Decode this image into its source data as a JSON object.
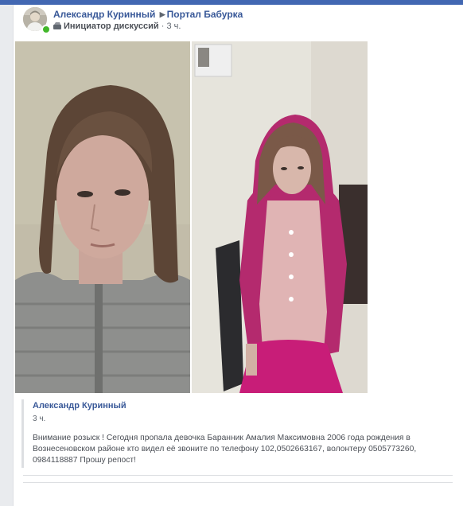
{
  "post": {
    "author": "Александр Куринный",
    "group": "Портал Бабурка",
    "role": "Инициатор дискуссий",
    "time": "3 ч.",
    "separator": "·"
  },
  "shared": {
    "author": "Александр Куринный",
    "time": "3 ч.",
    "text": "Внимание розыск ! Сегодня пропала девочка Баранник Амалия Максимовна 2006 года рождения в Вознесеновском районе кто видел её звоните по телефону 102,0502663167, волонтеру 0505773260, 0984118887 Прошу репост!"
  },
  "icons": [
    "triangle-right-icon",
    "discussion-starter-icon",
    "online-indicator-icon"
  ],
  "colors": {
    "link": "#385898",
    "muted": "#606770",
    "online": "#42b72a",
    "text": "#4b4f56"
  }
}
